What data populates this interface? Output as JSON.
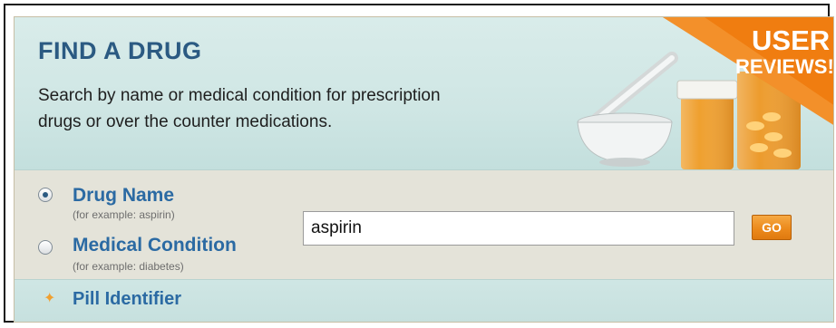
{
  "widget": {
    "title": "FIND A DRUG",
    "description": "Search by name or medical condition for prescription drugs or over the counter medications.",
    "badge": {
      "line1": "USER",
      "line2": "REVIEWS!"
    },
    "options": [
      {
        "label": "Drug Name",
        "hint": "(for example: aspirin)",
        "checked": true
      },
      {
        "label": "Medical Condition",
        "hint": "(for example: diabetes)",
        "checked": false
      }
    ],
    "search": {
      "value": "aspirin"
    },
    "go_label": "GO",
    "pill_identifier": "Pill Identifier"
  },
  "colors": {
    "title": "#2b5a82",
    "link": "#2b6aa3",
    "badge": "#f07d10",
    "go_button": "#ec8a1c",
    "header_bg": "#d9ecea",
    "search_bg": "#e4e3d9"
  }
}
